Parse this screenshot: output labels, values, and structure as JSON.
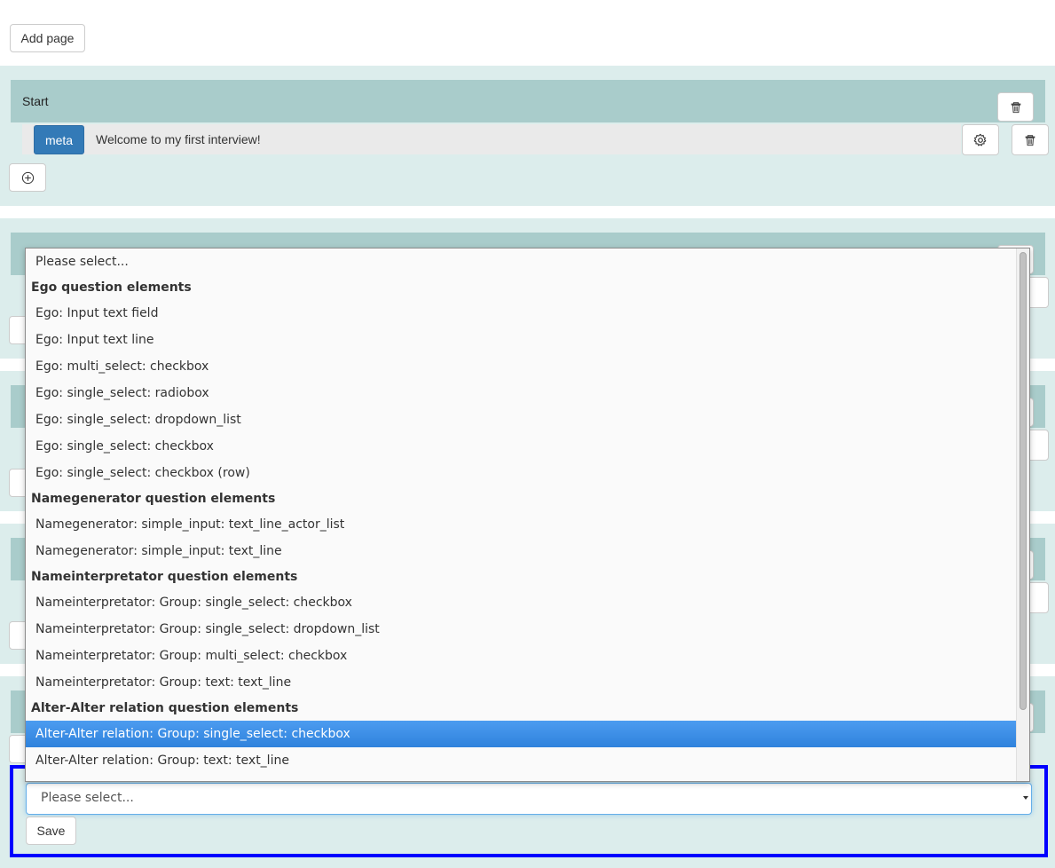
{
  "toolbar": {
    "add_page_label": "Add page"
  },
  "pages": [
    {
      "title": "Start",
      "elements": [
        {
          "badge": "meta",
          "text": "Welcome to my first interview!"
        }
      ]
    }
  ],
  "dropdown": {
    "options": [
      {
        "kind": "option",
        "label": "Please select..."
      },
      {
        "kind": "group",
        "label": "Ego question elements"
      },
      {
        "kind": "option",
        "label": "Ego: Input text field"
      },
      {
        "kind": "option",
        "label": "Ego: Input text line"
      },
      {
        "kind": "option",
        "label": "Ego: multi_select: checkbox"
      },
      {
        "kind": "option",
        "label": "Ego: single_select: radiobox"
      },
      {
        "kind": "option",
        "label": "Ego: single_select: dropdown_list"
      },
      {
        "kind": "option",
        "label": "Ego: single_select: checkbox"
      },
      {
        "kind": "option",
        "label": "Ego: single_select: checkbox (row)"
      },
      {
        "kind": "group",
        "label": "Namegenerator question elements"
      },
      {
        "kind": "option",
        "label": "Namegenerator: simple_input: text_line_actor_list"
      },
      {
        "kind": "option",
        "label": "Namegenerator: simple_input: text_line"
      },
      {
        "kind": "group",
        "label": "Nameinterpretator question elements"
      },
      {
        "kind": "option",
        "label": "Nameinterpretator: Group: single_select: checkbox"
      },
      {
        "kind": "option",
        "label": "Nameinterpretator: Group: single_select: dropdown_list"
      },
      {
        "kind": "option",
        "label": "Nameinterpretator: Group: multi_select: checkbox"
      },
      {
        "kind": "option",
        "label": "Nameinterpretator: Group: text: text_line"
      },
      {
        "kind": "group",
        "label": "Alter-Alter relation question elements"
      },
      {
        "kind": "option",
        "label": "Alter-Alter relation: Group: single_select: checkbox",
        "selected": true
      },
      {
        "kind": "option",
        "label": "Alter-Alter relation: Group: text: text_line"
      }
    ]
  },
  "add_element_form": {
    "select_value": "Please select...",
    "save_label": "Save"
  },
  "icons": {
    "trash": "trash-icon",
    "gear": "gear-icon",
    "add": "plus-circle-icon"
  },
  "colors": {
    "page_bg": "#dcedec",
    "header_bg": "#a9cccb",
    "badge": "#337ab7",
    "selected_option": "#3b8ee6",
    "form_focus_border": "#0000ff"
  }
}
